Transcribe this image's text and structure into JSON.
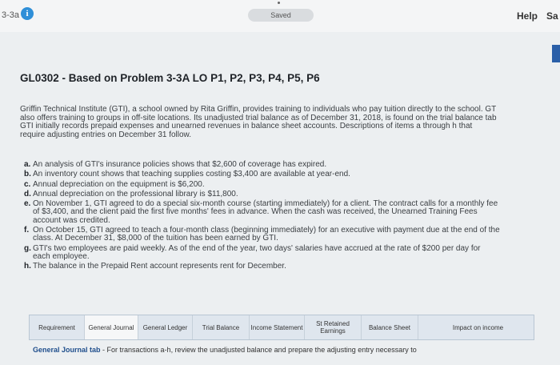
{
  "topbar": {
    "problem_id": "3-3a",
    "info_icon": "info-icon",
    "saved_label": "Saved",
    "help_label": "Help",
    "save_label": "Sa",
    "accent": "#2f8fd8",
    "tab_marker_color": "#2a5fa8"
  },
  "main": {
    "title": "GL0302 - Based on Problem 3-3A LO P1, P2, P3, P4, P5, P6",
    "intro_lines": [
      "Griffin Technical Institute (GTI), a school owned by Rita Griffin, provides training to individuals who pay tuition directly to the school. GT",
      "also offers training to groups in off-site locations. Its unadjusted trial balance as of December 31, 2018, is found on the trial balance tab",
      "GTI initially records prepaid expenses and unearned revenues in balance sheet accounts. Descriptions of items a through h that",
      "require adjusting entries on December 31 follow."
    ],
    "items": [
      {
        "letter": "a.",
        "lines": [
          "An analysis of GTI's insurance policies shows that $2,600 of coverage has expired."
        ]
      },
      {
        "letter": "b.",
        "lines": [
          "An inventory count shows that teaching supplies costing $3,400 are available at year-end."
        ]
      },
      {
        "letter": "c.",
        "lines": [
          "Annual depreciation on the equipment is $6,200."
        ]
      },
      {
        "letter": "d.",
        "lines": [
          "Annual depreciation on the professional library is $11,800."
        ]
      },
      {
        "letter": "e.",
        "lines": [
          "On November 1, GTI agreed to do a special six-month course (starting immediately) for a client. The contract calls for a monthly fee",
          "of $3,400, and the client paid the first five months' fees in advance. When the cash was received, the Unearned Training Fees",
          "account was credited."
        ]
      },
      {
        "letter": "f.",
        "lines": [
          "On October 15, GTI agreed to teach a four-month class (beginning immediately) for an executive with payment due at the end of the",
          "class. At December 31, $8,000 of the tuition has been earned by GTI."
        ]
      },
      {
        "letter": "g.",
        "lines": [
          "GTI's two employees are paid weekly. As of the end of the year, two days' salaries have accrued at the rate of $200 per day for",
          "each employee."
        ]
      },
      {
        "letter": "h.",
        "lines": [
          "The balance in the Prepaid Rent account represents rent for December."
        ]
      }
    ]
  },
  "tabs": [
    {
      "label": "Requirement"
    },
    {
      "label": "General Journal"
    },
    {
      "label": "General Ledger"
    },
    {
      "label": "Trial Balance"
    },
    {
      "label": "Income Statement"
    },
    {
      "label": "St Retained Earnings"
    },
    {
      "label": "Balance Sheet"
    },
    {
      "label": "Impact on income"
    }
  ],
  "footer": {
    "tab_name": "General Journal tab",
    "instruction": " - For transactions a-h, review the unadjusted balance and prepare the adjusting entry necessary to"
  }
}
